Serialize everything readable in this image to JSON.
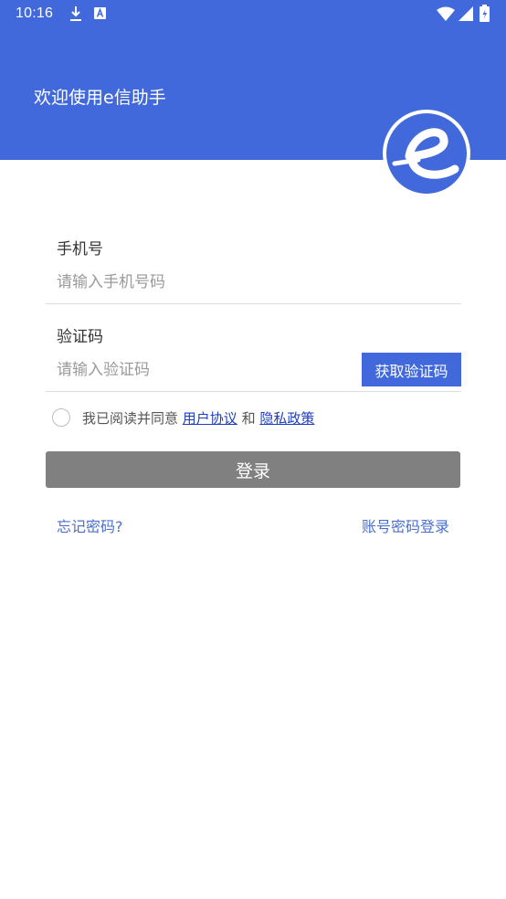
{
  "status_bar": {
    "time": "10:16",
    "icons": [
      "download-icon",
      "a-notification-icon",
      "wifi-icon",
      "signal-icon",
      "battery-icon"
    ]
  },
  "header": {
    "title": "欢迎使用e信助手",
    "logo_icon": "e-logo-icon",
    "background_color": "#4169DB"
  },
  "form": {
    "phone": {
      "label": "手机号",
      "placeholder": "请输入手机号码",
      "value": ""
    },
    "code": {
      "label": "验证码",
      "placeholder": "请输入验证码",
      "value": "",
      "get_code_label": "获取验证码"
    },
    "agreement": {
      "prefix": "我已阅读并同意",
      "user_agreement": "用户协议",
      "and": "和",
      "privacy_policy": "隐私政策",
      "checked": false
    },
    "login_label": "登录",
    "forgot_label": "忘记密码?",
    "account_login_label": "账号密码登录"
  },
  "colors": {
    "accent": "#4169DB",
    "login_disabled": "#808080",
    "link": "#1f3fbf"
  }
}
